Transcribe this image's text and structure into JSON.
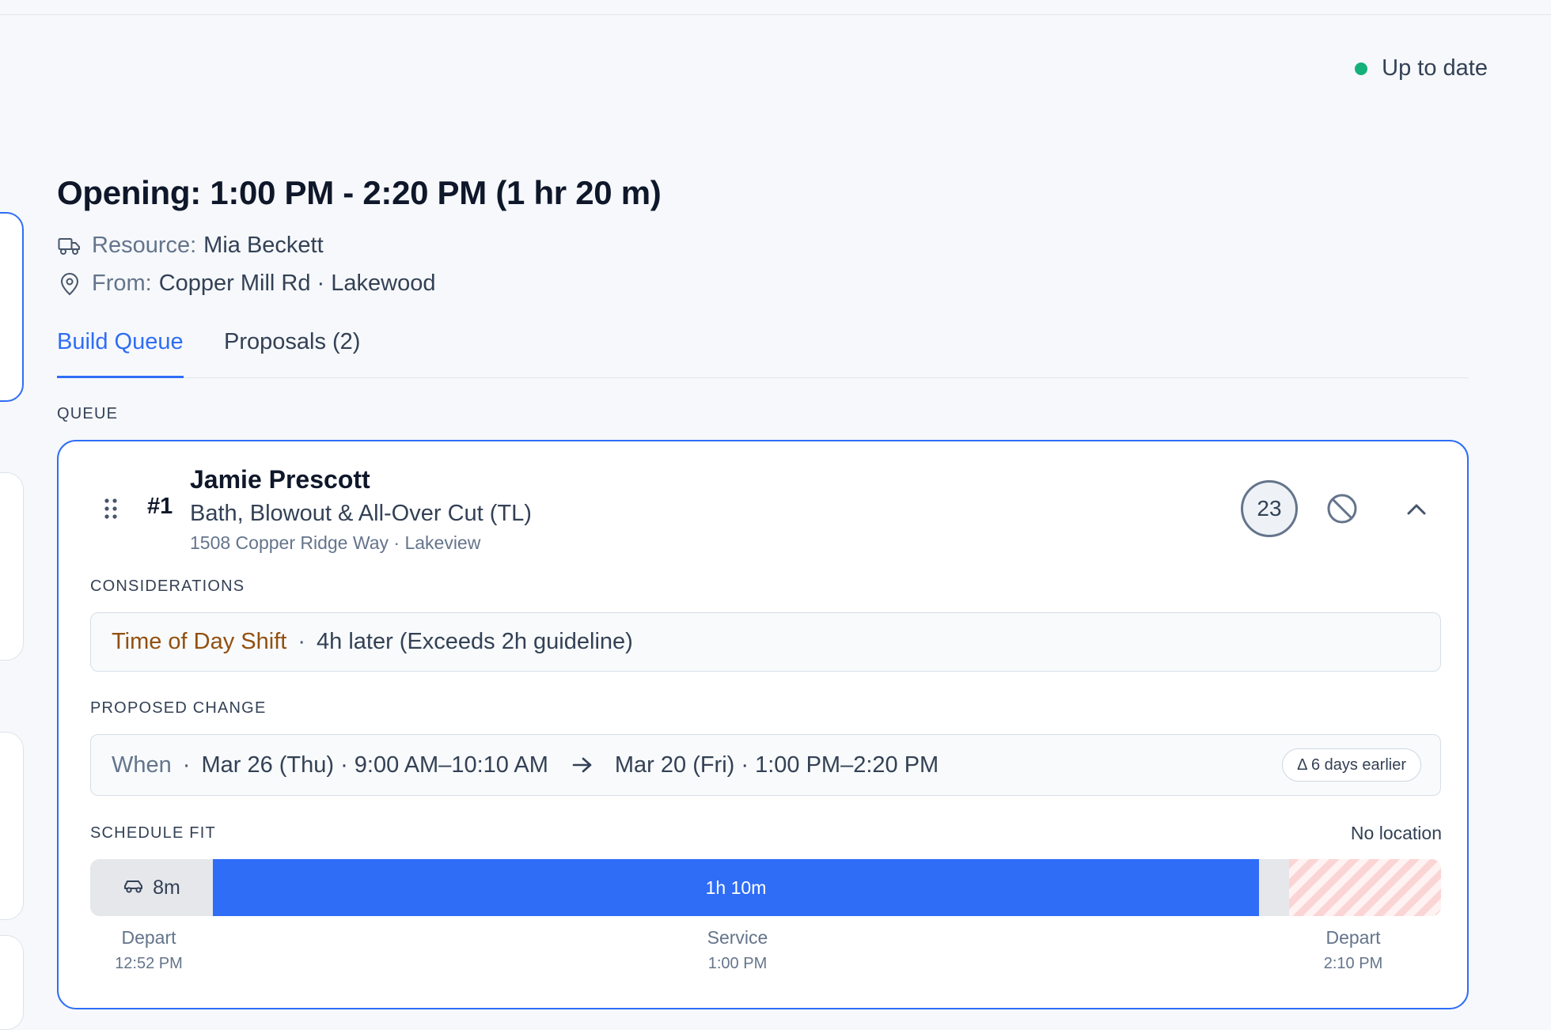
{
  "status": {
    "text": "Up to date",
    "color": "#16b07a"
  },
  "opening": {
    "title": "Opening: 1:00 PM - 2:20 PM (1 hr 20 m)",
    "resource_label": "Resource:",
    "resource_value": "Mia Beckett",
    "from_label": "From:",
    "from_value": "Copper Mill Rd · Lakewood"
  },
  "tabs": [
    {
      "label": "Build Queue",
      "active": true
    },
    {
      "label": "Proposals (2)",
      "active": false
    }
  ],
  "queue_label": "QUEUE",
  "queue_item": {
    "rank": "#1",
    "client_name": "Jamie Prescott",
    "service": "Bath, Blowout & All-Over Cut (TL)",
    "address": "1508 Copper Ridge Way · Lakeview",
    "score": "23",
    "considerations_label": "CONSIDERATIONS",
    "consideration": {
      "type": "Time of Day Shift",
      "separator": "·",
      "detail": "4h later (Exceeds 2h guideline)"
    },
    "proposed_label": "PROPOSED CHANGE",
    "proposed": {
      "when_label": "When",
      "separator": "·",
      "from": "Mar 26 (Thu) · 9:00 AM–10:10 AM",
      "to": "Mar 20 (Fri) · 1:00 PM–2:20 PM",
      "delta": "Δ 6 days earlier"
    },
    "schedule_fit_label": "SCHEDULE FIT",
    "location_note": "No location",
    "schedule": {
      "travel_label": "8m",
      "service_label": "1h 10m",
      "ticks": [
        {
          "name": "Depart",
          "time": "12:52 PM"
        },
        {
          "name": "Service",
          "time": "1:00 PM"
        },
        {
          "name": "Depart",
          "time": "2:10 PM"
        }
      ]
    }
  },
  "colors": {
    "accent": "#2f6df6",
    "warning_text": "#92500e",
    "blocked": "#fbd5d5"
  }
}
